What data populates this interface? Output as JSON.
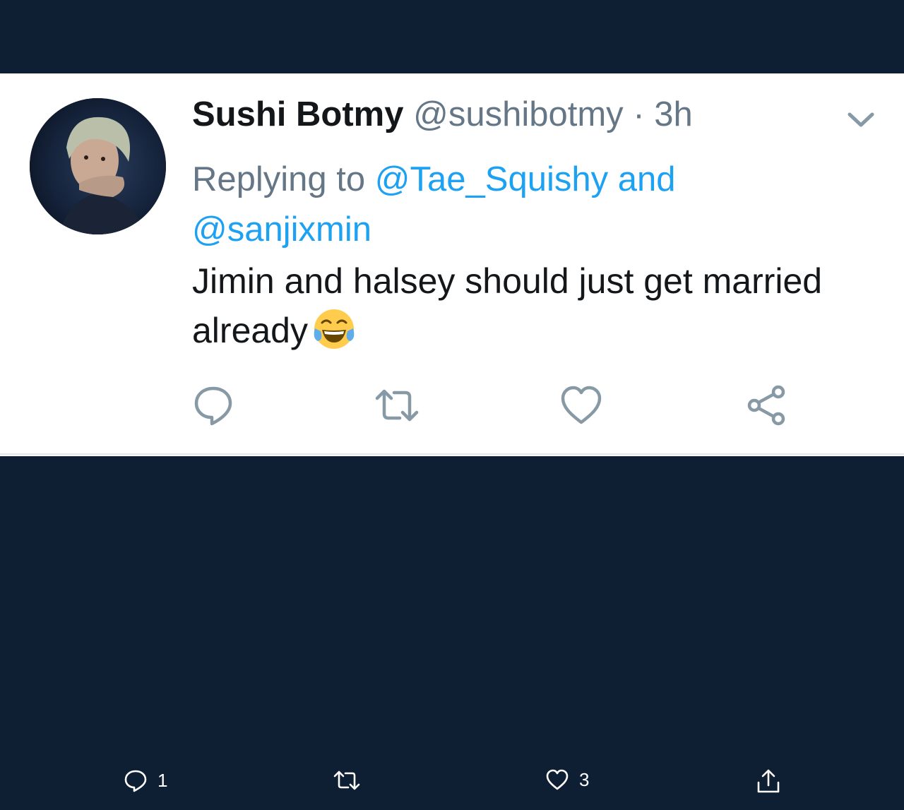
{
  "tweet": {
    "display_name": "Sushi Botmy",
    "handle": "@sushibotmy",
    "separator": "·",
    "time": "3h",
    "replying_prefix": "Replying to",
    "mention_1": "@Tae_Squishy",
    "mention_joiner": "and",
    "mention_2": "@sanjixmin",
    "text": "Jimin and halsey should just get married already",
    "emoji": "face-with-tears-of-joy"
  },
  "actions": {
    "reply_icon": "reply-icon",
    "retweet_icon": "retweet-icon",
    "like_icon": "heart-icon",
    "share_icon": "share-icon"
  },
  "bottom_bar": {
    "reply_count": "1",
    "like_count": "3"
  },
  "colors": {
    "background": "#0f1f33",
    "card": "#ffffff",
    "mention": "#1da1f2",
    "muted": "#657786",
    "text": "#14171a"
  }
}
